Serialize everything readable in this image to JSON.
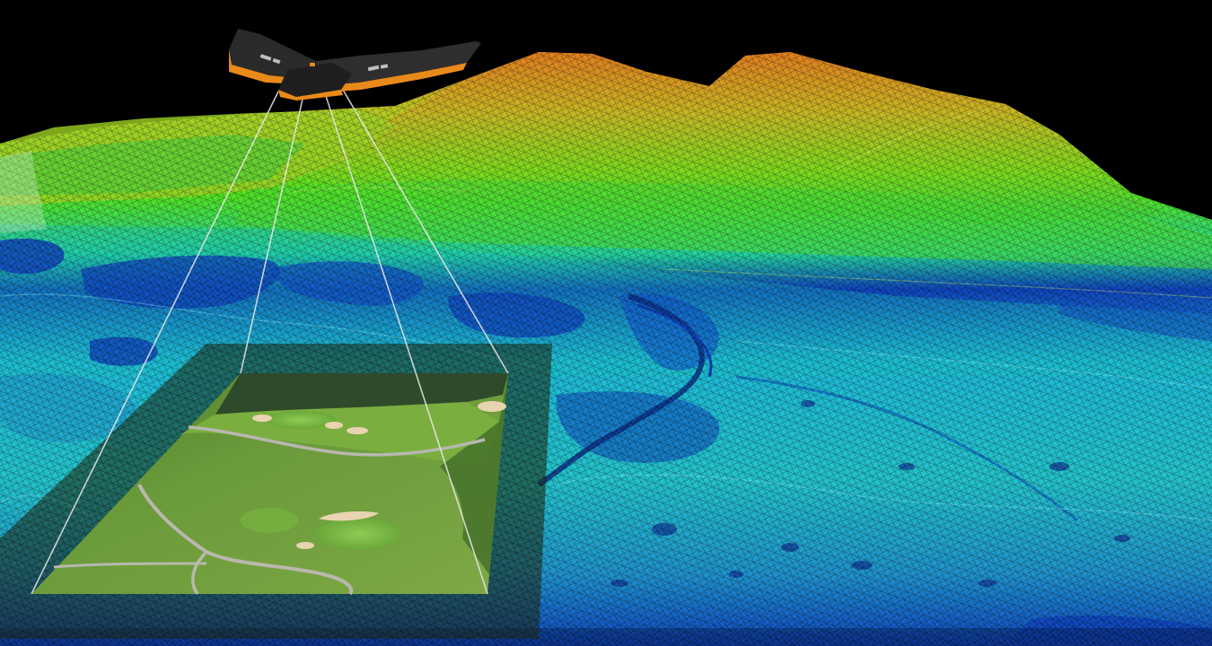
{
  "scene": {
    "background_color": "#000000",
    "terrain_elevation_palette": {
      "low": "#0a3fb8",
      "low_mid": "#18b7d6",
      "mid": "#1fcf9a",
      "high_mid": "#4fe01a",
      "high": "#b8c81e",
      "peak": "#e07a1a"
    },
    "orthophoto_palette": {
      "fairway": "#6a9a3a",
      "green": "#7fb848",
      "rough": "#4f7a2a",
      "cart_path": "#b8b8ae",
      "bunker": "#e8d4b0",
      "water": "#2f4a2a"
    },
    "drone_colors": {
      "body": "#2a2a2a",
      "wing_edge": "#e88a1a",
      "wing_marking": "#d8d8d8"
    },
    "drone_markings": "",
    "elements": [
      "wireframe-terrain-model",
      "fixed-wing-drone",
      "sensor-projection-lines",
      "aerial-orthophoto-footprint"
    ]
  }
}
